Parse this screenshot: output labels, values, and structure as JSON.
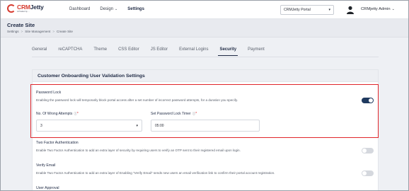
{
  "brand": {
    "logo_main": "CRM",
    "logo_accent": "Jetty",
    "logo_tagline": "A Product by ..."
  },
  "nav": {
    "dashboard": "Dashboard",
    "design": "Design",
    "settings": "Settings"
  },
  "portal_select": {
    "value": "CRMJetty Portal"
  },
  "user": {
    "name": "CRMjetty Admin"
  },
  "page": {
    "title": "Create Site",
    "breadcrumb": [
      "Settings",
      "Site Management",
      "Create Site"
    ]
  },
  "tabs": [
    "General",
    "reCAPTCHA",
    "Theme",
    "CSS Editor",
    "JS Editor",
    "External Logins",
    "Security",
    "Payment"
  ],
  "active_tab": "Security",
  "card": {
    "title": "Customer Onboarding User Validation Settings",
    "password_lock": {
      "title": "Password Lock",
      "description": "Enabling the password lock will temporarily block portal access after a set number of incorrect password attempts, for a duration you specify.",
      "enabled": true,
      "wrong_attempts_label": "No. Of Wrong Attempts",
      "wrong_attempts_value": "3",
      "timer_label": "Set Password Lock Timer",
      "timer_value": "05:00"
    },
    "two_factor": {
      "title": "Two Factor Authentication",
      "description": "Enable Two Factor Authentication to add an extra layer of security by requiring users to verify an OTP sent to their registered email upon login.",
      "enabled": false
    },
    "verify_email": {
      "title": "Verify Email",
      "description": "Enable Two Factor Authentication to add an extra layer of Enabling \"Verify Email\" sends new users an email verification link to confirm their portal account registration.",
      "enabled": false
    },
    "user_approval": {
      "title": "User Approval"
    }
  },
  "colors": {
    "accent": "#1f3a5f",
    "highlight": "#e0262b",
    "brand_red": "#d63b2f"
  }
}
